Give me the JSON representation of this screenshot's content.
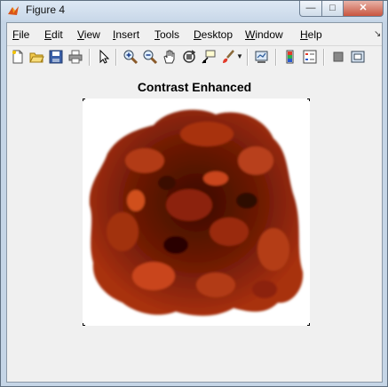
{
  "window": {
    "title": "Figure 4"
  },
  "menu": {
    "items": [
      {
        "label": "File",
        "u": "F",
        "rest": "ile"
      },
      {
        "label": "Edit",
        "u": "E",
        "rest": "dit"
      },
      {
        "label": "View",
        "u": "V",
        "rest": "iew"
      },
      {
        "label": "Insert",
        "u": "I",
        "rest": "nsert"
      },
      {
        "label": "Tools",
        "u": "T",
        "rest": "ools"
      },
      {
        "label": "Desktop",
        "u": "D",
        "rest": "esktop"
      },
      {
        "label": "Window",
        "u": "W",
        "rest": "indow"
      },
      {
        "label": "Help",
        "u": "H",
        "rest": "elp"
      }
    ]
  },
  "toolbar": {
    "icons": [
      "new-figure-icon",
      "open-file-icon",
      "save-icon",
      "print-icon",
      "edit-plot-icon",
      "zoom-in-icon",
      "zoom-out-icon",
      "pan-icon",
      "rotate-3d-icon",
      "data-cursor-icon",
      "brush-icon",
      "brush-dropdown-icon",
      "link-plot-icon",
      "colorbar-icon",
      "legend-icon",
      "hide-plot-tools-icon",
      "show-plot-tools-icon"
    ]
  },
  "plot": {
    "title": "Contrast Enhanced"
  },
  "colors": {
    "blob_dark": "#3a0a02",
    "blob_mid": "#8c2208",
    "blob_light": "#c9451a"
  }
}
